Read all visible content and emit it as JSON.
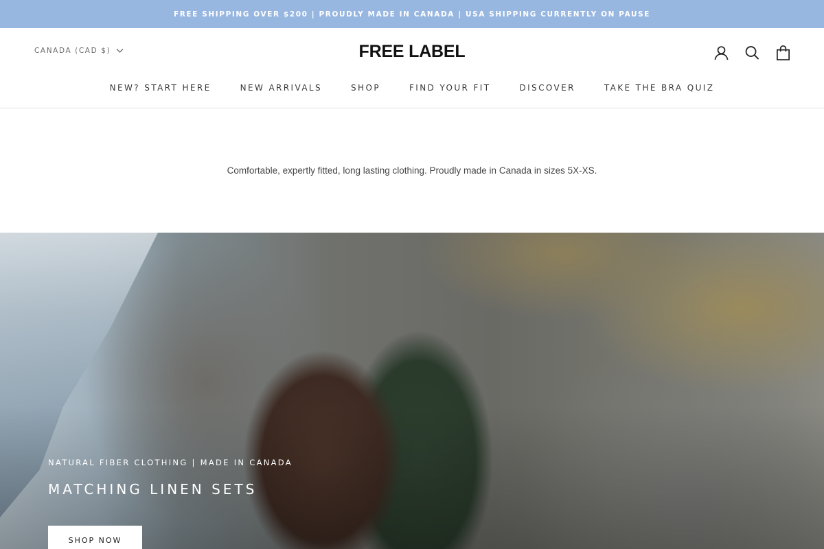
{
  "announcement": {
    "text": "FREE SHIPPING OVER $200 | PROUDLY MADE IN CANADA | USA SHIPPING CURRENTLY ON PAUSE",
    "background": "#97b6e0"
  },
  "header": {
    "currency": "CANADA (CAD $)",
    "logo": "FREE LABEL",
    "icons": [
      "account-icon",
      "search-icon",
      "cart-icon"
    ]
  },
  "nav": {
    "items": [
      {
        "label": "NEW? START HERE"
      },
      {
        "label": "NEW ARRIVALS"
      },
      {
        "label": "SHOP"
      },
      {
        "label": "FIND YOUR FIT"
      },
      {
        "label": "DISCOVER"
      },
      {
        "label": "TAKE THE BRA QUIZ"
      }
    ]
  },
  "tagline": "Comfortable, expertly fitted, long lasting clothing. Proudly made in Canada in sizes 5X-XS.",
  "hero": {
    "subtitle": "NATURAL FIBER CLOTHING | MADE IN CANADA",
    "title": "MATCHING LINEN SETS",
    "button": "SHOP NOW"
  }
}
